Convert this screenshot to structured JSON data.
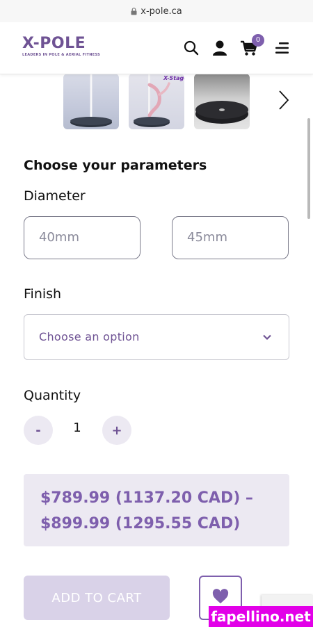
{
  "browser": {
    "url": "x-pole.ca"
  },
  "header": {
    "logo_title": "X-POLE",
    "logo_tagline": "LEADERS IN POLE & AERIAL FITNESS",
    "cart_count": "0"
  },
  "gallery": {
    "thumb2_label": "X-Stage"
  },
  "params": {
    "heading": "Choose your parameters",
    "diameter_label": "Diameter",
    "diameter_options": [
      "40mm",
      "45mm"
    ],
    "finish_label": "Finish",
    "finish_selected": "Choose an option",
    "quantity_label": "Quantity",
    "quantity_value": "1",
    "minus_label": "-",
    "plus_label": "+"
  },
  "price": {
    "line1": "$789.99 (1137.20 CAD) –",
    "line2": "$899.99 (1295.55 CAD)"
  },
  "actions": {
    "add_to_cart_label": "ADD TO CART"
  },
  "watermark": "fapellino.net",
  "colors": {
    "brand": "#6f5394",
    "accent": "#7e5fad",
    "price_bg": "#ece9f2"
  }
}
